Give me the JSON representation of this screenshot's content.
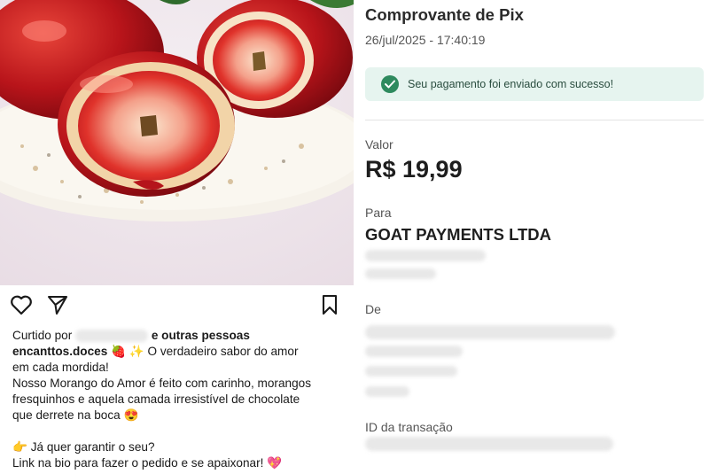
{
  "post": {
    "image_alt": "Morango do amor cortado ao meio sobre prato",
    "liked_prefix": "Curtido por",
    "liked_suffix": "e outras pessoas",
    "username": "encanttos.doces",
    "caption_line1_text": " 🍓 ✨ O verdadeiro sabor do amor",
    "caption_line2": "em cada mordida!",
    "caption_line3": "Nosso Morango do Amor é feito com carinho, morangos",
    "caption_line4": "fresquinhos e aquela camada irresistível de chocolate",
    "caption_line5": "que derrete na boca 😍",
    "caption_line6": "👉 Já quer garantir o seu?",
    "caption_line7": "Link na bio para fazer o pedido e se apaixonar! 💖",
    "icons": [
      "heart-icon",
      "send-icon",
      "bookmark-icon"
    ]
  },
  "receipt": {
    "title": "Comprovante de Pix",
    "datetime": "26/jul/2025 - 17:40:19",
    "success_message": "Seu pagamento foi enviado com sucesso!",
    "value_label": "Valor",
    "amount": "R$ 19,99",
    "to_label": "Para",
    "payee": "GOAT PAYMENTS LTDA",
    "from_label": "De",
    "transaction_label": "ID da transação",
    "success_color": "#2e8a5e"
  }
}
